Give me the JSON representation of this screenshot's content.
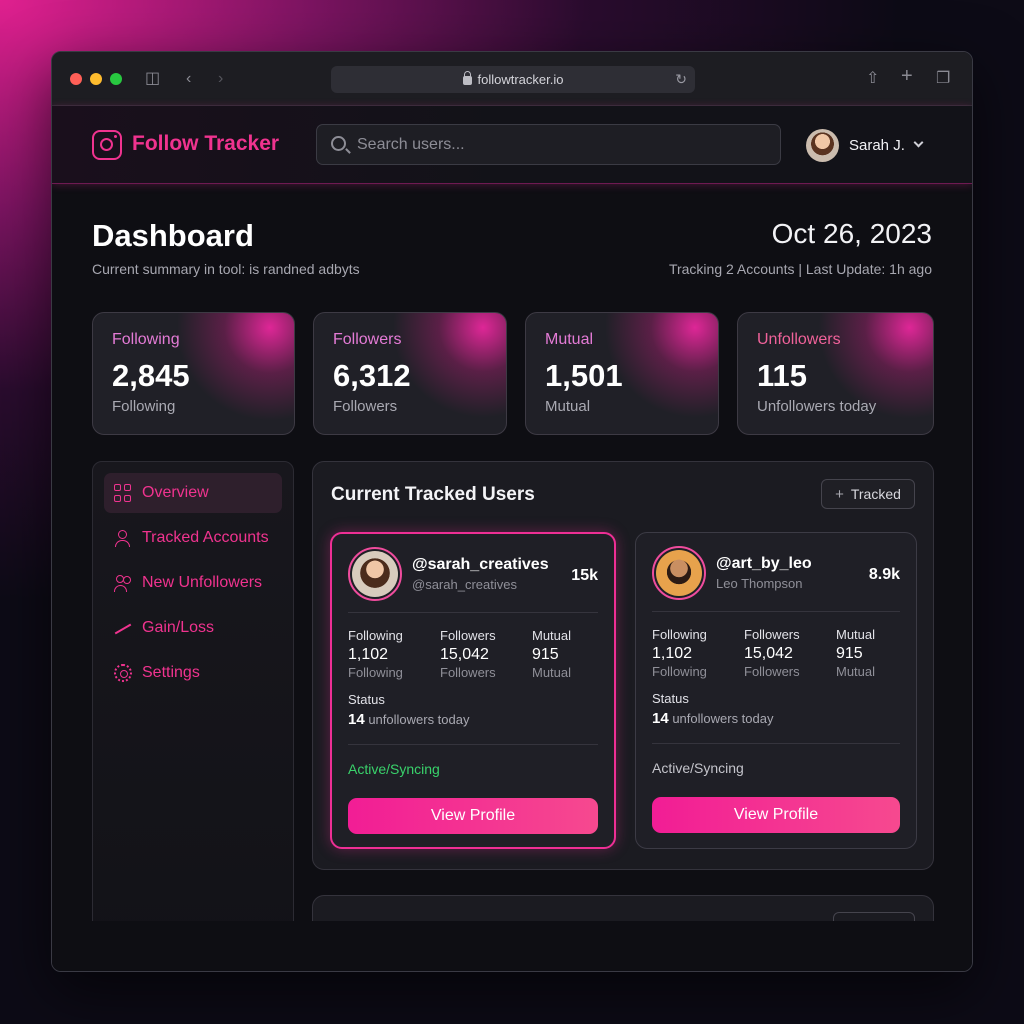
{
  "browser": {
    "url": "followtracker.io"
  },
  "header": {
    "brand": "Follow Tracker",
    "search_placeholder": "Search users...",
    "user_name": "Sarah J."
  },
  "dashboard": {
    "title": "Dashboard",
    "subtitle": "Current summary in tool: is randned adbyts",
    "date": "Oct 26, 2023",
    "tracking": "Tracking 2 Accounts | Last Update: 1h ago"
  },
  "stats": [
    {
      "label": "Following",
      "value": "2,845",
      "sub": "Following"
    },
    {
      "label": "Followers",
      "value": "6,312",
      "sub": "Followers"
    },
    {
      "label": "Mutual",
      "value": "1,501",
      "sub": "Mutual"
    },
    {
      "label": "Unfollowers",
      "value": "115",
      "sub": "Unfollowers today"
    }
  ],
  "sidebar": {
    "items": [
      {
        "label": "Overview",
        "icon": "grid-icon",
        "active": true
      },
      {
        "label": "Tracked Accounts",
        "icon": "user-plus-icon"
      },
      {
        "label": "New Unfollowers",
        "icon": "users-icon"
      },
      {
        "label": "Gain/Loss",
        "icon": "trending-up-icon"
      },
      {
        "label": "Settings",
        "icon": "gear-icon"
      }
    ]
  },
  "tracked": {
    "title": "Current Tracked Users",
    "button": "Tracked",
    "cards": [
      {
        "handle": "@sarah_creatives",
        "name": "@sarah_creatives",
        "count": "15k",
        "following_label": "Following",
        "following": "1,102",
        "following_sub": "Following",
        "followers_label": "Followers",
        "followers": "15,042",
        "followers_sub": "Followers",
        "mutual_label": "Mutual",
        "mutual": "915",
        "mutual_sub": "Mutual",
        "status_label": "Status",
        "status_count": "14",
        "status_text": "unfollowers today",
        "sync": "Active/Syncing",
        "button": "View Profile"
      },
      {
        "handle": "@art_by_leo",
        "name": "Leo Thompson",
        "count": "8.9k",
        "following_label": "Following",
        "following": "1,102",
        "following_sub": "Following",
        "followers_label": "Followers",
        "followers": "15,042",
        "followers_sub": "Followers",
        "mutual_label": "Mutual",
        "mutual": "915",
        "mutual_sub": "Mutual",
        "status_label": "Status",
        "status_count": "14",
        "status_text": "unfollowers today",
        "sync": "Active/Syncing",
        "button": "View Profile"
      }
    ]
  },
  "colors": {
    "accent": "#f0338f",
    "sync_active": "#39d26b"
  }
}
